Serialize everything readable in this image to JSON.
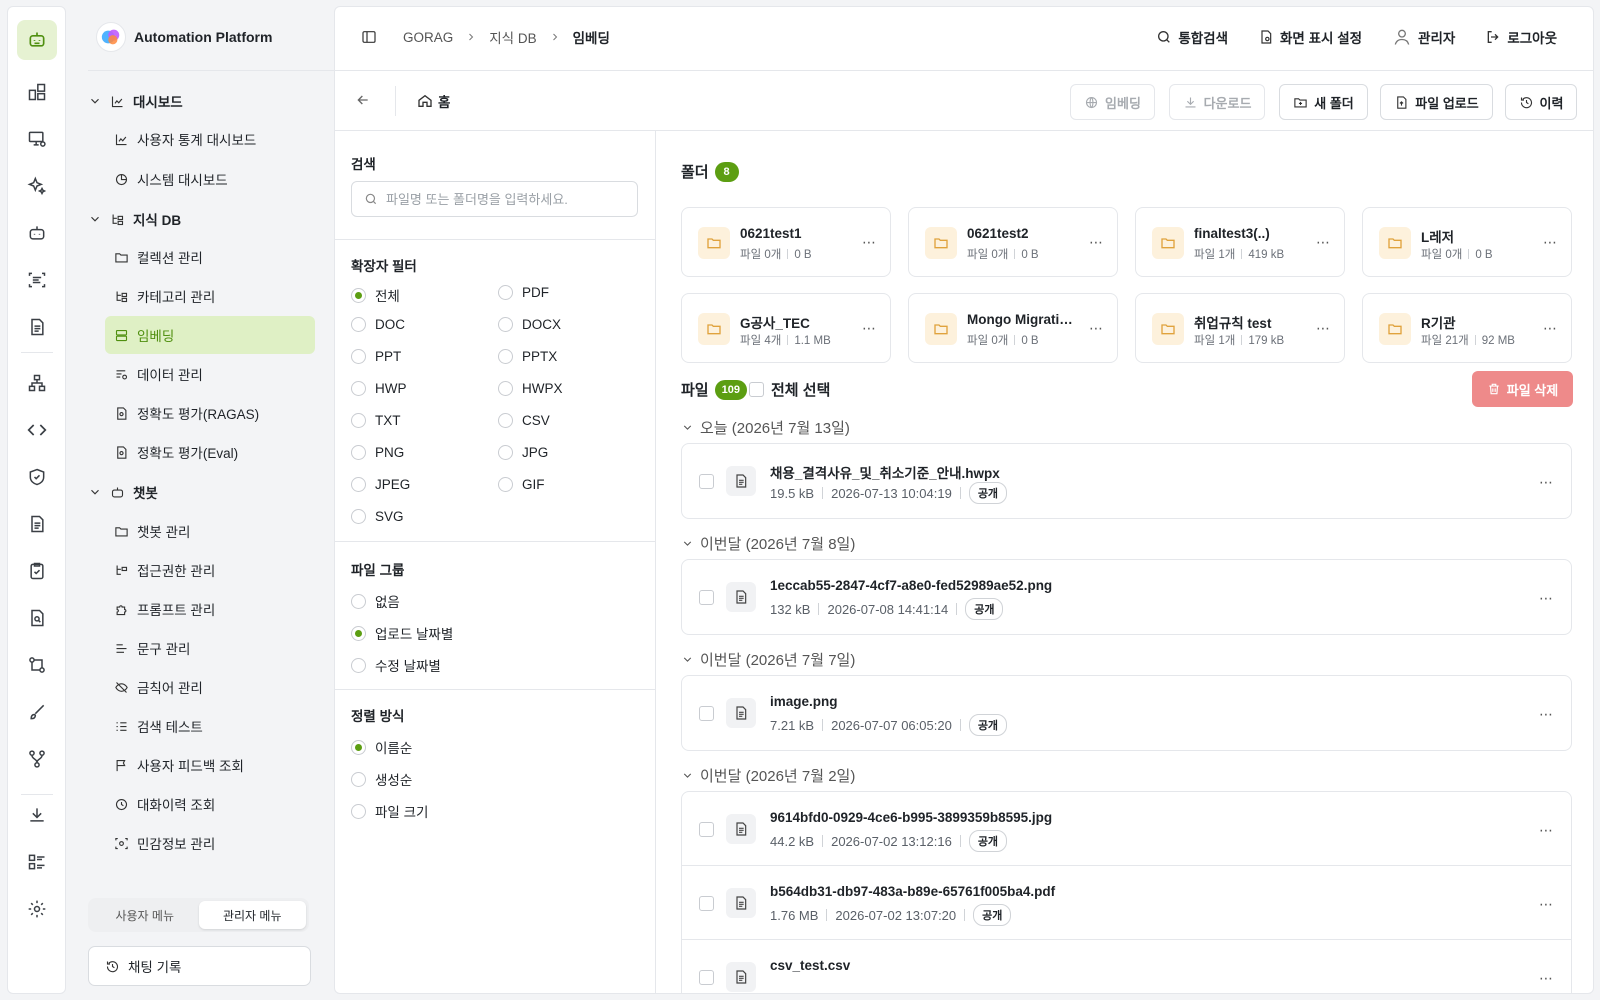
{
  "app": {
    "title": "Automation Platform"
  },
  "breadcrumb": {
    "items": [
      "GORAG",
      "지식 DB",
      "임베딩"
    ]
  },
  "top_actions": {
    "search": "통합검색",
    "display": "화면 표시 설정",
    "user": "관리자",
    "logout": "로그아웃"
  },
  "sidebar": {
    "groups": [
      {
        "label": "대시보드",
        "items": [
          "사용자 통계 대시보드",
          "시스템 대시보드"
        ]
      },
      {
        "label": "지식 DB",
        "items": [
          "컬렉션 관리",
          "카테고리 관리",
          "임베딩",
          "데이터 관리",
          "정확도 평가(RAGAS)",
          "정확도 평가(Eval)"
        ]
      },
      {
        "label": "챗봇",
        "items": [
          "챗봇 관리",
          "접근권한 관리",
          "프롬프트 관리",
          "문구 관리",
          "금칙어 관리",
          "검색 테스트",
          "사용자 피드백 조회",
          "대화이력 조회",
          "민감정보 관리"
        ]
      }
    ],
    "selected": "임베딩",
    "menu_toggle": {
      "user": "사용자 메뉴",
      "admin": "관리자 메뉴",
      "active": "관리자 메뉴"
    },
    "chat_history": "채팅 기록"
  },
  "toolbar": {
    "home": "홈",
    "embed": "임베딩",
    "download": "다운로드",
    "new_folder": "새 폴더",
    "upload": "파일 업로드",
    "history": "이력"
  },
  "filter": {
    "search_title": "검색",
    "search_placeholder": "파일명 또는 폴더명을 입력하세요.",
    "ext_title": "확장자 필터",
    "extensions": [
      "전체",
      "PDF",
      "DOC",
      "DOCX",
      "PPT",
      "PPTX",
      "HWP",
      "HWPX",
      "TXT",
      "CSV",
      "PNG",
      "JPG",
      "JPEG",
      "GIF",
      "SVG"
    ],
    "ext_selected": "전체",
    "group_title": "파일 그룹",
    "groups": [
      "없음",
      "업로드 날짜별",
      "수정 날짜별"
    ],
    "group_selected": "업로드 날짜별",
    "sort_title": "정렬 방식",
    "sorts": [
      "이름순",
      "생성순",
      "파일 크기"
    ],
    "sort_selected": "이름순"
  },
  "folders": {
    "title": "폴더",
    "count": "8",
    "items": [
      {
        "name": "0621test1",
        "files": "파일 0개",
        "size": "0 B"
      },
      {
        "name": "0621test2",
        "files": "파일 0개",
        "size": "0 B"
      },
      {
        "name": "finaltest3(..)",
        "files": "파일 1개",
        "size": "419 kB"
      },
      {
        "name": "L레저",
        "files": "파일 0개",
        "size": "0 B"
      },
      {
        "name": "G공사_TEC",
        "files": "파일 4개",
        "size": "1.1 MB"
      },
      {
        "name": "Mongo Migrati…",
        "files": "파일 0개",
        "size": "0 B"
      },
      {
        "name": "취업규칙 test",
        "files": "파일 1개",
        "size": "179 kB"
      },
      {
        "name": "R기관",
        "files": "파일 21개",
        "size": "92 MB"
      }
    ]
  },
  "files": {
    "title": "파일",
    "count": "109",
    "select_all": "전체 선택",
    "delete": "파일 삭제",
    "groups": [
      {
        "label": "오늘 (2026년 7월 13일)",
        "items": [
          {
            "name": "채용_결격사유_및_취소기준_안내.hwpx",
            "size": "19.5 kB",
            "date": "2026-07-13 10:04:19",
            "badge": "공개"
          }
        ]
      },
      {
        "label": "이번달 (2026년 7월 8일)",
        "items": [
          {
            "name": "1eccab55-2847-4cf7-a8e0-fed52989ae52.png",
            "size": "132 kB",
            "date": "2026-07-08 14:41:14",
            "badge": "공개"
          }
        ]
      },
      {
        "label": "이번달 (2026년 7월 7일)",
        "items": [
          {
            "name": "image.png",
            "size": "7.21 kB",
            "date": "2026-07-07 06:05:20",
            "badge": "공개"
          }
        ]
      },
      {
        "label": "이번달 (2026년 7월 2일)",
        "items": [
          {
            "name": "9614bfd0-0929-4ce6-b995-3899359b8595.jpg",
            "size": "44.2 kB",
            "date": "2026-07-02 13:12:16",
            "badge": "공개"
          },
          {
            "name": "b564db31-db97-483a-b89e-65761f005ba4.pdf",
            "size": "1.76 MB",
            "date": "2026-07-02 13:07:20",
            "badge": "공개"
          },
          {
            "name": "csv_test.csv",
            "size": "",
            "date": "",
            "badge": ""
          }
        ]
      }
    ]
  },
  "colors": {
    "accent": "#5c9e12",
    "accent_bg": "#dff0c5",
    "danger": "#ee8a8a",
    "folder_bg": "#fdf1dc"
  }
}
